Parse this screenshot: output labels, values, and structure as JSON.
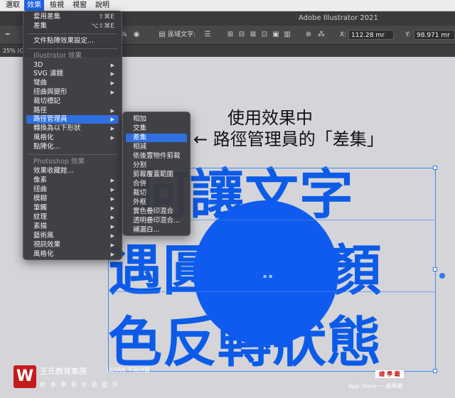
{
  "menubar": {
    "items": [
      {
        "label": "選取"
      },
      {
        "label": "效果"
      },
      {
        "label": "檢視"
      },
      {
        "label": "視窗"
      },
      {
        "label": "說明"
      }
    ]
  },
  "window": {
    "title": "Adobe Illustrator 2021"
  },
  "controlbar": {
    "zoom": "%",
    "area_text_label": "區域文字:",
    "x_label": "X:",
    "x_value": "112.28 mr",
    "y_label": "Y:",
    "y_value": "98.971 mr"
  },
  "doc_tab": {
    "label": "25% (CM"
  },
  "effect_menu": {
    "apply_last": {
      "label": "套用差集",
      "shortcut": "⇧⌘E"
    },
    "last_effect": {
      "label": "差集",
      "shortcut": "⌥⇧⌘E"
    },
    "doc_raster_settings": "文件點陣效果設定...",
    "illustrator_header": "Illustrator 效果",
    "illustrator_items": [
      {
        "label": "3D"
      },
      {
        "label": "SVG 濾鏡"
      },
      {
        "label": "彎曲"
      },
      {
        "label": "扭曲與變形"
      },
      {
        "label": "裁切標記"
      },
      {
        "label": "路徑"
      },
      {
        "label": "路徑管理員"
      },
      {
        "label": "轉換為以下形狀"
      },
      {
        "label": "風格化"
      },
      {
        "label": "點陣化..."
      }
    ],
    "photoshop_header": "Photoshop 效果",
    "photoshop_items": [
      {
        "label": "效果收藏館..."
      },
      {
        "label": "像素"
      },
      {
        "label": "扭曲"
      },
      {
        "label": "模糊"
      },
      {
        "label": "筆觸"
      },
      {
        "label": "紋理"
      },
      {
        "label": "素描"
      },
      {
        "label": "藝術風"
      },
      {
        "label": "視訊效果"
      },
      {
        "label": "風格化"
      }
    ]
  },
  "pathfinder_submenu": {
    "items": [
      {
        "label": "相加"
      },
      {
        "label": "交集"
      },
      {
        "label": "差集"
      },
      {
        "label": "相減"
      },
      {
        "label": "依後置物件剪裁"
      },
      {
        "label": "分割"
      },
      {
        "label": "剪裁覆蓋範圍"
      },
      {
        "label": "合併"
      },
      {
        "label": "裁切"
      },
      {
        "label": "外框"
      },
      {
        "label": "實色疊印混合"
      },
      {
        "label": "透明疊印混合..."
      },
      {
        "label": "補漏白..."
      }
    ]
  },
  "annotation": {
    "line1": "使用效果中",
    "line2": "← 路徑管理員的「差集」"
  },
  "artwork": {
    "line1": "何讓文字",
    "line2": "遇圓形變顏",
    "line3": "色反轉狀態",
    "color": "#0c5be8"
  },
  "watermark": {
    "logo": "W",
    "name": "王氏教育集團",
    "sub": "LEARN  不為分散",
    "slogan": "終 身 學 習 全 面 提 升",
    "badge": "繪 學 霸",
    "right": "App Store 一 繪學霸"
  },
  "colors": {
    "accent": "#2f6fe0",
    "menu_bg": "#3a3a3e",
    "brand_red": "#c41c1c"
  }
}
